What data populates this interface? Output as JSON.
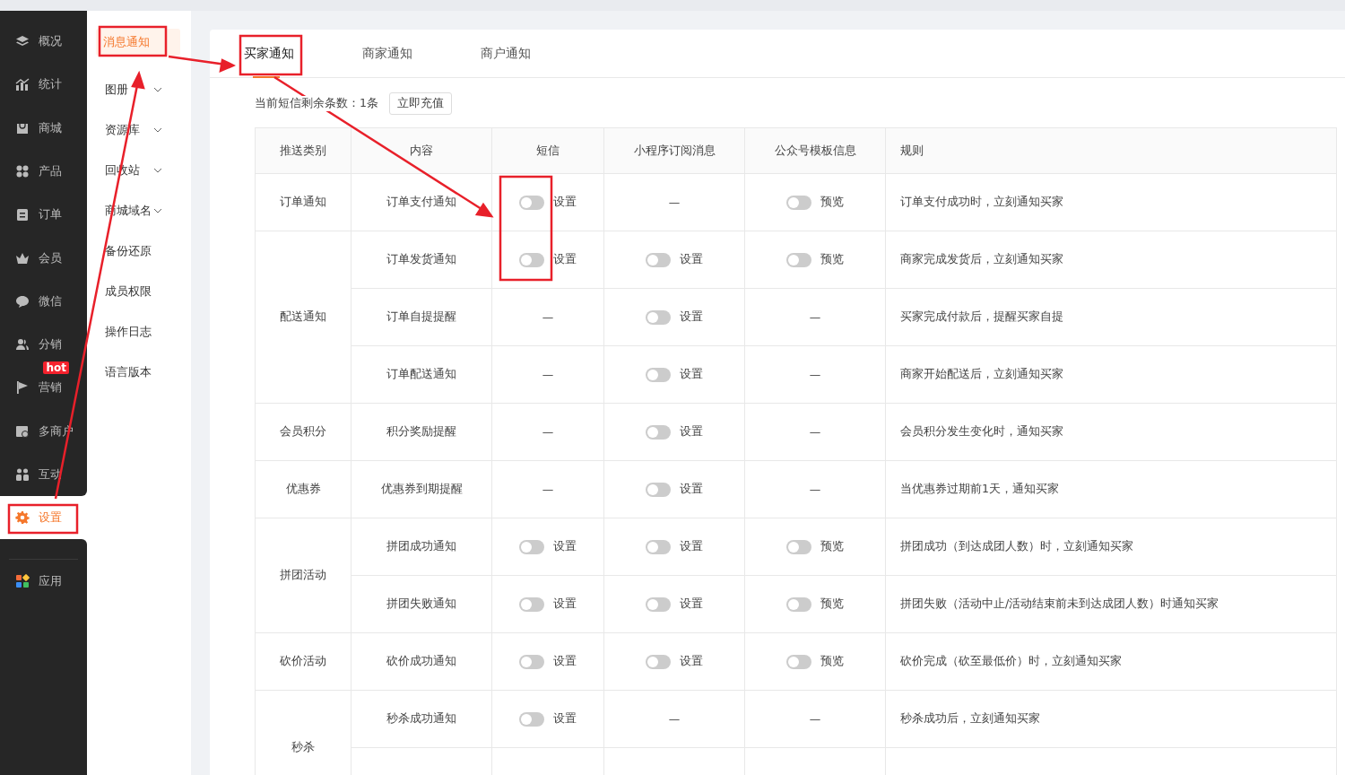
{
  "sidebar": {
    "items": [
      {
        "label": "概况",
        "selected": false
      },
      {
        "label": "统计",
        "selected": false
      },
      {
        "label": "商城",
        "selected": false
      },
      {
        "label": "产品",
        "selected": false
      },
      {
        "label": "订单",
        "selected": false
      },
      {
        "label": "会员",
        "selected": false
      },
      {
        "label": "微信",
        "selected": false
      },
      {
        "label": "分销",
        "selected": false
      },
      {
        "label": "营销",
        "selected": false,
        "badge": "hot"
      },
      {
        "label": "多商户",
        "selected": false
      },
      {
        "label": "互动",
        "selected": false
      },
      {
        "label": "设置",
        "selected": true
      }
    ],
    "bottom_items": [
      {
        "label": "应用",
        "selected": false
      }
    ]
  },
  "submenu": {
    "items": [
      {
        "label": "消息通知",
        "selected": true,
        "expandable": false
      },
      {
        "label": "图册",
        "selected": false,
        "expandable": true
      },
      {
        "label": "资源库",
        "selected": false,
        "expandable": true
      },
      {
        "label": "回收站",
        "selected": false,
        "expandable": true
      },
      {
        "label": "商城域名",
        "selected": false,
        "expandable": true
      },
      {
        "label": "备份还原",
        "selected": false,
        "expandable": false
      },
      {
        "label": "成员权限",
        "selected": false,
        "expandable": false
      },
      {
        "label": "操作日志",
        "selected": false,
        "expandable": false
      },
      {
        "label": "语言版本",
        "selected": false,
        "expandable": false
      }
    ]
  },
  "tabs": [
    {
      "label": "买家通知",
      "selected": true
    },
    {
      "label": "商家通知",
      "selected": false
    },
    {
      "label": "商户通知",
      "selected": false
    }
  ],
  "sms_balance": {
    "text": "当前短信剩余条数：1条",
    "button": "立即充值"
  },
  "table": {
    "columns": [
      "推送类别",
      "内容",
      "短信",
      "小程序订阅消息",
      "公众号模板信息",
      "规则"
    ],
    "groups": [
      {
        "category": "订单通知",
        "rows": [
          {
            "content": "订单支付通知",
            "sms": {
              "kind": "toggle",
              "on": false,
              "label": "设置"
            },
            "mini": {
              "kind": "dash",
              "text": "—"
            },
            "official": {
              "kind": "toggle",
              "on": false,
              "label": "预览"
            },
            "rule": "订单支付成功时，立刻通知买家"
          }
        ]
      },
      {
        "category": "配送通知",
        "rows": [
          {
            "content": "订单发货通知",
            "sms": {
              "kind": "toggle",
              "on": false,
              "label": "设置"
            },
            "mini": {
              "kind": "toggle",
              "on": false,
              "label": "设置"
            },
            "official": {
              "kind": "toggle",
              "on": false,
              "label": "预览"
            },
            "rule": "商家完成发货后，立刻通知买家"
          },
          {
            "content": "订单自提提醒",
            "sms": {
              "kind": "dash",
              "text": "—"
            },
            "mini": {
              "kind": "toggle",
              "on": false,
              "label": "设置"
            },
            "official": {
              "kind": "dash",
              "text": "—"
            },
            "rule": "买家完成付款后，提醒买家自提"
          },
          {
            "content": "订单配送通知",
            "sms": {
              "kind": "dash",
              "text": "—"
            },
            "mini": {
              "kind": "toggle",
              "on": false,
              "label": "设置"
            },
            "official": {
              "kind": "dash",
              "text": "—"
            },
            "rule": "商家开始配送后，立刻通知买家"
          }
        ]
      },
      {
        "category": "会员积分",
        "rows": [
          {
            "content": "积分奖励提醒",
            "sms": {
              "kind": "dash",
              "text": "—"
            },
            "mini": {
              "kind": "toggle",
              "on": false,
              "label": "设置"
            },
            "official": {
              "kind": "dash",
              "text": "—"
            },
            "rule": "会员积分发生变化时，通知买家"
          }
        ]
      },
      {
        "category": "优惠券",
        "rows": [
          {
            "content": "优惠券到期提醒",
            "sms": {
              "kind": "dash",
              "text": "—"
            },
            "mini": {
              "kind": "toggle",
              "on": false,
              "label": "设置"
            },
            "official": {
              "kind": "dash",
              "text": "—"
            },
            "rule": "当优惠券过期前1天，通知买家"
          }
        ]
      },
      {
        "category": "拼团活动",
        "rows": [
          {
            "content": "拼团成功通知",
            "sms": {
              "kind": "toggle",
              "on": false,
              "label": "设置"
            },
            "mini": {
              "kind": "toggle",
              "on": false,
              "label": "设置"
            },
            "official": {
              "kind": "toggle",
              "on": false,
              "label": "预览"
            },
            "rule": "拼团成功（到达成团人数）时，立刻通知买家"
          },
          {
            "content": "拼团失败通知",
            "sms": {
              "kind": "toggle",
              "on": false,
              "label": "设置"
            },
            "mini": {
              "kind": "toggle",
              "on": false,
              "label": "设置"
            },
            "official": {
              "kind": "toggle",
              "on": false,
              "label": "预览"
            },
            "rule": "拼团失败（活动中止/活动结束前未到达成团人数）时通知买家"
          }
        ]
      },
      {
        "category": "砍价活动",
        "rows": [
          {
            "content": "砍价成功通知",
            "sms": {
              "kind": "toggle",
              "on": false,
              "label": "设置"
            },
            "mini": {
              "kind": "toggle",
              "on": false,
              "label": "设置"
            },
            "official": {
              "kind": "toggle",
              "on": false,
              "label": "预览"
            },
            "rule": "砍价完成（砍至最低价）时，立刻通知买家"
          }
        ]
      },
      {
        "category": "秒杀",
        "rows": [
          {
            "content": "秒杀成功通知",
            "sms": {
              "kind": "toggle",
              "on": false,
              "label": "设置"
            },
            "mini": {
              "kind": "dash",
              "text": "—"
            },
            "official": {
              "kind": "dash",
              "text": "—"
            },
            "rule": "秒杀成功后，立刻通知买家"
          }
        ]
      }
    ]
  }
}
